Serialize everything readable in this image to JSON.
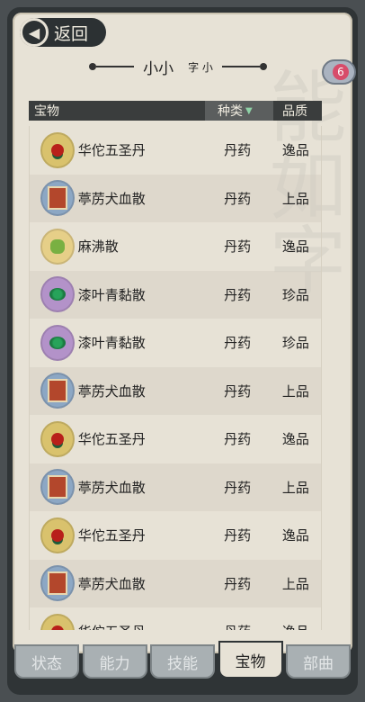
{
  "back": {
    "label": "返回"
  },
  "title": {
    "main": "小小",
    "sub": "字 小"
  },
  "badge": {
    "count": "6"
  },
  "table": {
    "headers": {
      "name": "宝物",
      "type": "种类",
      "quality": "品质"
    },
    "rows": [
      {
        "name": "华佗五圣丹",
        "type": "丹药",
        "quality": "逸品",
        "icon": "pill-icon"
      },
      {
        "name": "葶苈犬血散",
        "type": "丹药",
        "quality": "上品",
        "icon": "book-icon"
      },
      {
        "name": "麻沸散",
        "type": "丹药",
        "quality": "逸品",
        "icon": "herb-icon"
      },
      {
        "name": "漆叶青黏散",
        "type": "丹药",
        "quality": "珍品",
        "icon": "grapes-icon"
      },
      {
        "name": "漆叶青黏散",
        "type": "丹药",
        "quality": "珍品",
        "icon": "grapes-icon"
      },
      {
        "name": "葶苈犬血散",
        "type": "丹药",
        "quality": "上品",
        "icon": "book-icon"
      },
      {
        "name": "华佗五圣丹",
        "type": "丹药",
        "quality": "逸品",
        "icon": "pill-icon"
      },
      {
        "name": "葶苈犬血散",
        "type": "丹药",
        "quality": "上品",
        "icon": "book-icon"
      },
      {
        "name": "华佗五圣丹",
        "type": "丹药",
        "quality": "逸品",
        "icon": "pill-icon"
      },
      {
        "name": "葶苈犬血散",
        "type": "丹药",
        "quality": "上品",
        "icon": "book-icon"
      },
      {
        "name": "华佗五圣丹",
        "type": "丹药",
        "quality": "逸品",
        "icon": "pill-icon"
      }
    ]
  },
  "tabs": [
    {
      "label": "状态",
      "active": false
    },
    {
      "label": "能力",
      "active": false
    },
    {
      "label": "技能",
      "active": false
    },
    {
      "label": "宝物",
      "active": true
    },
    {
      "label": "部曲",
      "active": false
    }
  ]
}
